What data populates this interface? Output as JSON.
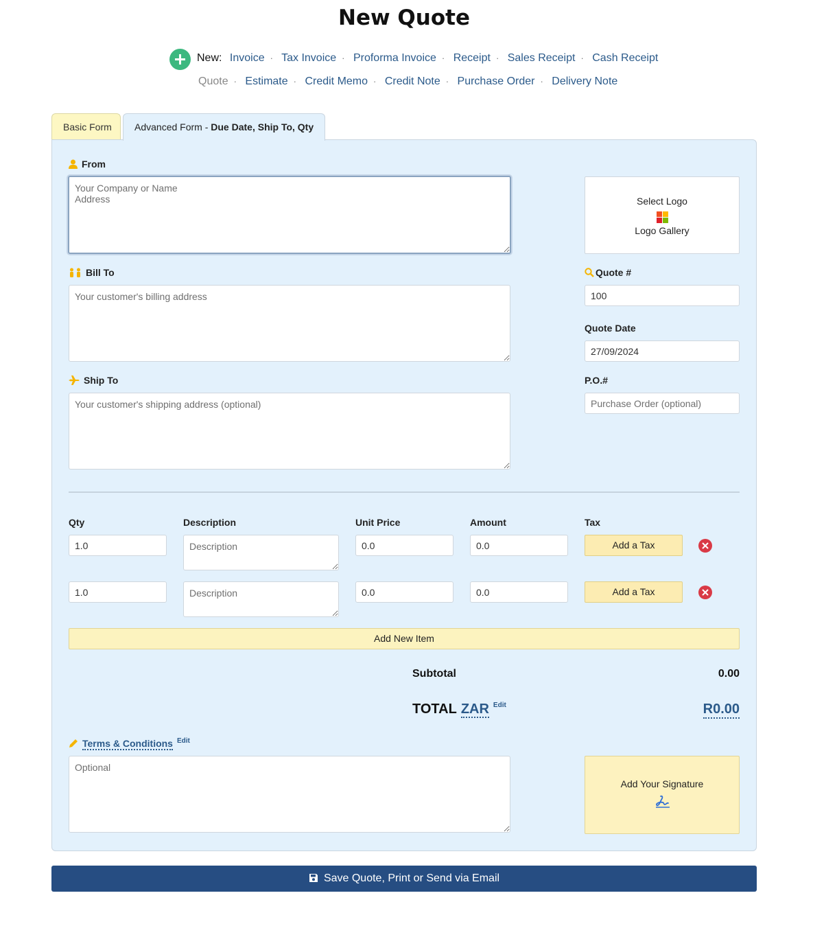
{
  "page": {
    "title": "New Quote"
  },
  "new_menu": {
    "label": "New:",
    "row1": [
      "Invoice",
      "Tax Invoice",
      "Proforma Invoice",
      "Receipt",
      "Sales Receipt",
      "Cash Receipt"
    ],
    "row2_current": "Quote",
    "row2": [
      "Estimate",
      "Credit Memo",
      "Credit Note",
      "Purchase Order",
      "Delivery Note"
    ]
  },
  "tabs": {
    "basic": "Basic Form",
    "advanced_prefix": "Advanced Form - ",
    "advanced_bold": "Due Date, Ship To, Qty"
  },
  "from": {
    "label": "From",
    "placeholder": "Your Company or Name\nAddress"
  },
  "logo": {
    "select": "Select Logo",
    "gallery": "Logo Gallery"
  },
  "bill_to": {
    "label": "Bill To",
    "placeholder": "Your customer's billing address"
  },
  "quote_number": {
    "label": "Quote #",
    "value": "100"
  },
  "quote_date": {
    "label": "Quote Date",
    "value": "27/09/2024"
  },
  "ship_to": {
    "label": "Ship To",
    "placeholder": "Your customer's shipping address (optional)"
  },
  "po": {
    "label": "P.O.#",
    "placeholder": "Purchase Order (optional)"
  },
  "items": {
    "headers": {
      "qty": "Qty",
      "description": "Description",
      "unit_price": "Unit Price",
      "amount": "Amount",
      "tax": "Tax"
    },
    "rows": [
      {
        "qty": "1.0",
        "description_placeholder": "Description",
        "unit_price": "0.0",
        "amount": "0.0",
        "tax_button": "Add a Tax"
      },
      {
        "qty": "1.0",
        "description_placeholder": "Description",
        "unit_price": "0.0",
        "amount": "0.0",
        "tax_button": "Add a Tax"
      }
    ],
    "add_new": "Add New Item"
  },
  "totals": {
    "subtotal_label": "Subtotal",
    "subtotal_value": "0.00",
    "total_label": "TOTAL",
    "currency": "ZAR",
    "edit": "Edit",
    "total_value": "R0.00"
  },
  "terms": {
    "label": "Terms & Conditions",
    "edit": "Edit",
    "placeholder": "Optional"
  },
  "signature": {
    "label": "Add Your Signature"
  },
  "save": {
    "label": "Save Quote, Print or Send via Email"
  },
  "colors": {
    "accent": "#2b5a8a",
    "panel": "#e3f1fc",
    "save_button": "#264d82",
    "tax_button": "#fcecb2",
    "remove": "#d93a46",
    "new_button": "#3cb87f"
  }
}
